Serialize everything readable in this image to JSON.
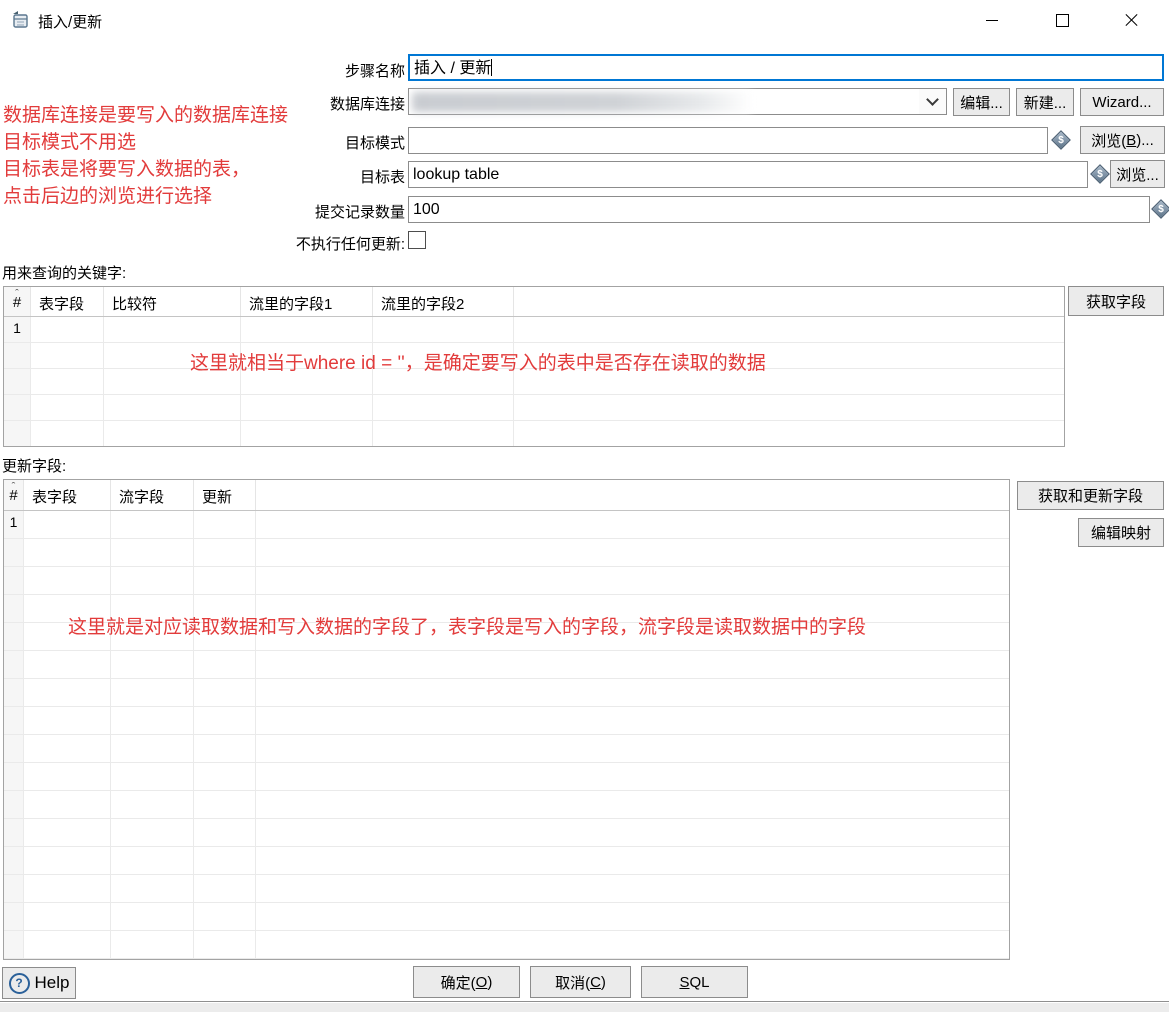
{
  "window": {
    "title": "插入/更新"
  },
  "form": {
    "step_name": {
      "label": "步骤名称",
      "value": "插入 / 更新"
    },
    "connection": {
      "label": "数据库连接",
      "edit": "编辑...",
      "new": "新建...",
      "wizard": "Wizard..."
    },
    "target_schema": {
      "label": "目标模式",
      "value": "",
      "browse": {
        "pre": "浏览(",
        "key": "B",
        "post": ")..."
      }
    },
    "target_table": {
      "label": "目标表",
      "value": "lookup table",
      "browse": "浏览..."
    },
    "commit_size": {
      "label": "提交记录数量",
      "value": "100"
    },
    "skip_updates": {
      "label": "不执行任何更新:",
      "checked": false
    }
  },
  "annotations": {
    "top_lines": [
      "数据库连接是要写入的数据库连接",
      "目标模式不用选",
      "目标表是将要写入数据的表，",
      "点击后边的浏览进行选择"
    ],
    "keys_note": "这里就相当于where id = ''，是确定要写入的表中是否存在读取的数据",
    "update_note": "这里就是对应读取数据和写入数据的字段了，表字段是写入的字段，流字段是读取数据中的字段"
  },
  "keys_section": {
    "label": "用来查询的关键字:",
    "headers": [
      "#",
      "表字段",
      "比较符",
      "流里的字段1",
      "流里的字段2"
    ],
    "first_row_number": "1",
    "get_fields_button": "获取字段"
  },
  "update_section": {
    "label": "更新字段:",
    "headers": [
      "#",
      "表字段",
      "流字段",
      "更新"
    ],
    "first_row_number": "1",
    "get_update_fields_button": "获取和更新字段",
    "edit_mapping_button": "编辑映射"
  },
  "icons": {
    "variable_glyph": "$",
    "help_glyph": "?"
  },
  "footer": {
    "help": "Help",
    "ok": {
      "pre": "确定(",
      "key": "O",
      "post": ")"
    },
    "cancel": {
      "pre": "取消(",
      "key": "C",
      "post": ")"
    },
    "sql": {
      "pre": "",
      "key": "S",
      "post": "QL"
    }
  },
  "colors": {
    "focus_blue": "#0077d4",
    "annotation_red": "#e23b3b"
  }
}
